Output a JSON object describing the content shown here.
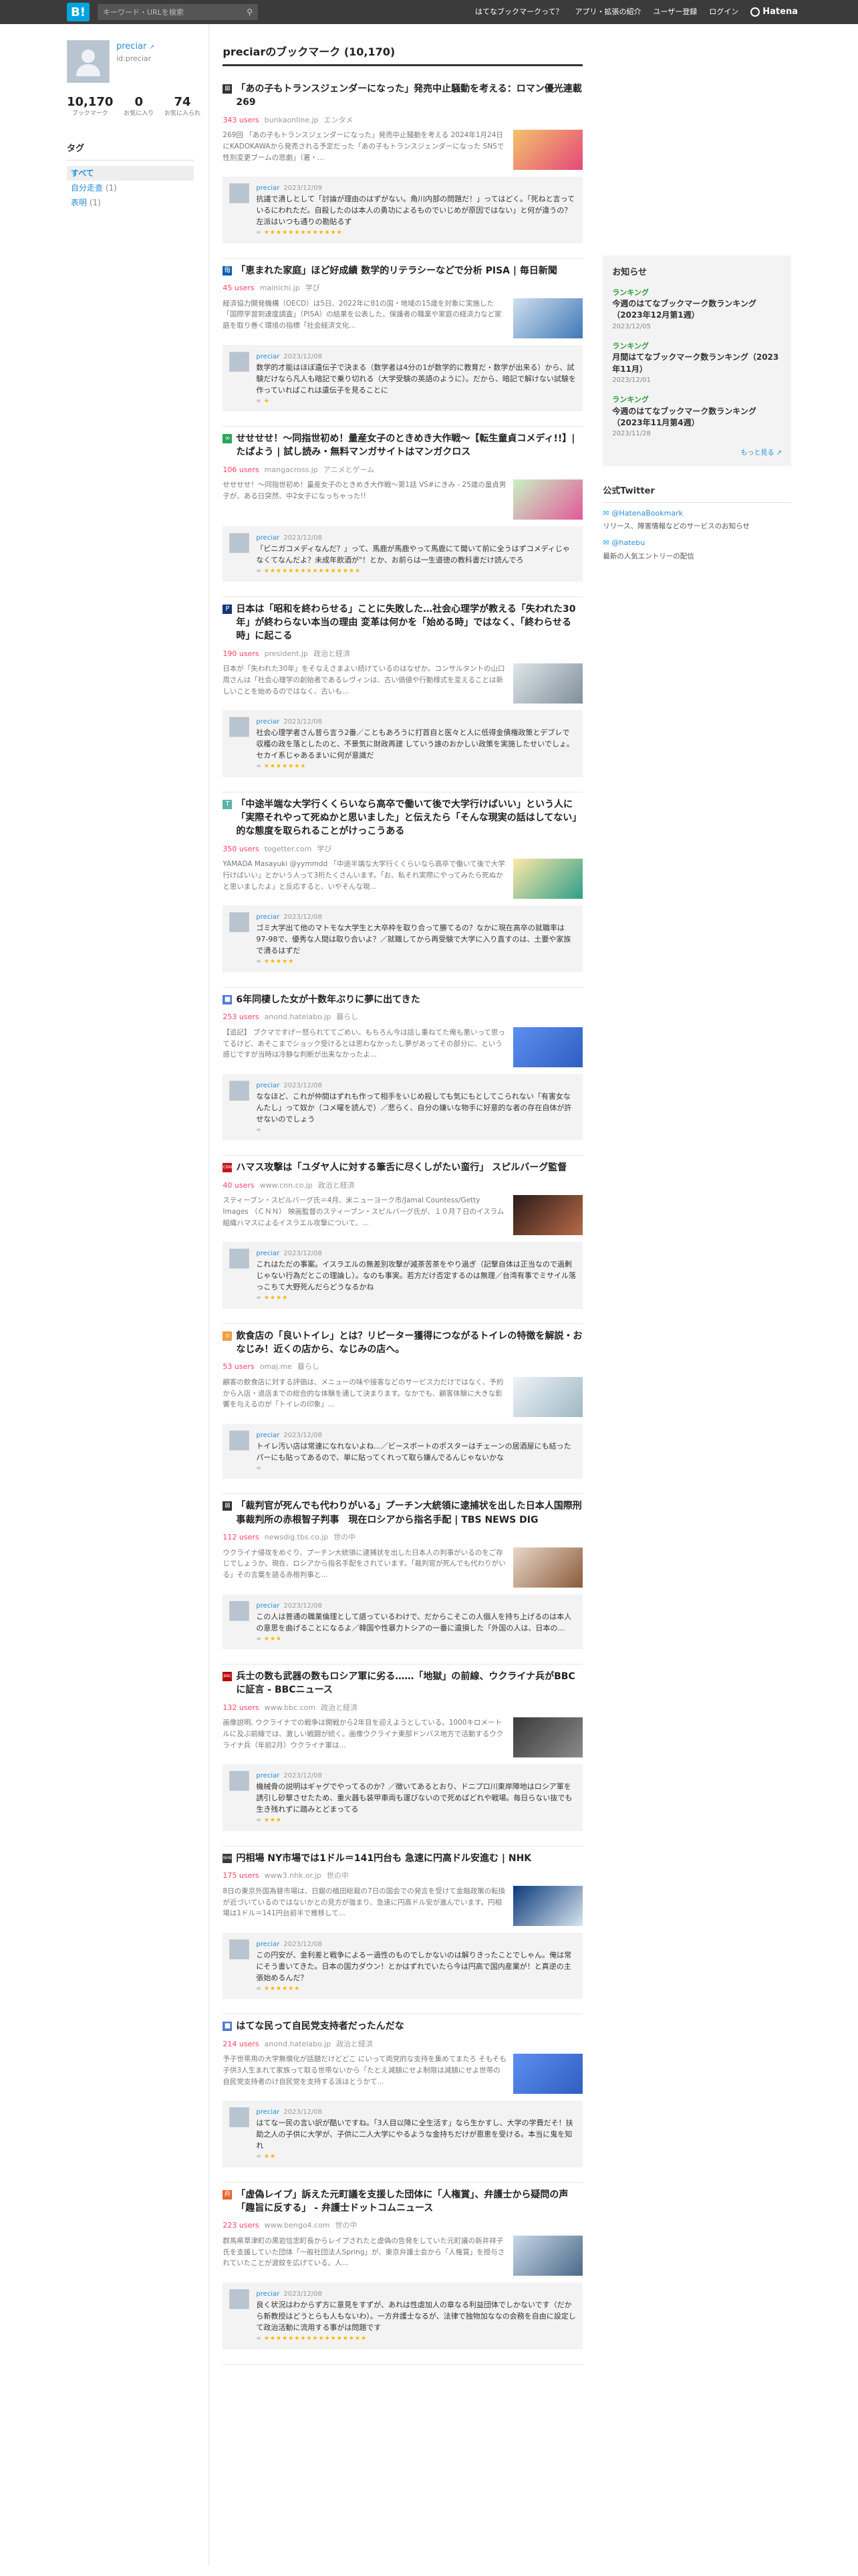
{
  "topbar": {
    "logo": "B!",
    "search_placeholder": "キーワード・URLを検索",
    "nav": [
      "はてなブックマークって？",
      "アプリ・拡張の紹介",
      "ユーザー登録",
      "ログイン"
    ],
    "brand": "Hatena"
  },
  "profile": {
    "name": "preciar",
    "id": "id:preciar",
    "stats": [
      {
        "num": "10,170",
        "label": "ブックマーク"
      },
      {
        "num": "0",
        "label": "お気に入り"
      },
      {
        "num": "74",
        "label": "お気に入られ"
      }
    ]
  },
  "tags": {
    "heading": "タグ",
    "items": [
      {
        "label": "すべて",
        "count": ""
      },
      {
        "label": "自分走查",
        "count": "(1)"
      },
      {
        "label": "表明",
        "count": "(1)"
      }
    ]
  },
  "main": {
    "heading": "preciarのブックマーク (10,170)",
    "entries": [
      {
        "title": "「あの子もトランスジェンダーになった」発売中止騒動を考える：ロマン優光連載269",
        "users": "343 users",
        "domain": "bunkaonline.jp",
        "category": "エンタメ",
        "favicon_color": "#333333",
        "favicon": "⊠",
        "desc": "269回 「あの子もトランスジェンダーになった」発売中止騒動を考える 2024年1月24日にKADOKAWAから発売される予定だった「あの子もトランスジェンダーになった SNSで性別変更ブームの悲劇」（著・...",
        "thumb": [
          "#f2c36b",
          "#e6477b"
        ],
        "user": "preciar",
        "date": "2023/12/09",
        "comment": "抗議で潰しとして「討論が理由のはずがない。角川内部の問題だ！」ってはどく。「死ねと言っているにわれただ。自殺したのは本人の勇功によるものでいじめが原因ではない」と何が違うの？左派はいつも通りの勘貼るず",
        "stars": "★★★★★★★★★★★★★"
      },
      {
        "title": "「恵まれた家庭」ほど好成績 数学的リテラシーなどで分析 PISA | 毎日新聞",
        "users": "45 users",
        "domain": "mainichi.jp",
        "category": "学び",
        "favicon_color": "#0b5fb5",
        "favicon": "毎",
        "desc": "経済協力開発機構（OECD）は5日、2022年に81の国・地域の15歳を対象に実施した「国際学習到達度調査」（PISA）の結果を公表した。保護者の職業や家庭の経済力など家庭を取り巻く環境の指標「社会経済文化...",
        "thumb": [
          "#cfe0ee",
          "#3f78b8"
        ],
        "user": "preciar",
        "date": "2023/12/08",
        "comment": "数学的才能はほぼ遺伝子で決まる（数学者は4分の1が数学的に教育だ・数学が出来る）から、試験だけなら凡人も暗記で乗り切れる（大学受験の英語のように）。だから、暗記で解けない試験を作っていればこれは遺伝子を見ることに",
        "stars": "★"
      },
      {
        "title": "せせせせ！～同指世初め！量産女子のときめき大作戦～【転生童貞コメディ!!】| たぱよう | 試し読み・無料マンガサイトはマンガクロス",
        "users": "106 users",
        "domain": "mangacross.jp",
        "category": "アニメとゲーム",
        "favicon_color": "#2aa55a",
        "favicon": "∞",
        "desc": "せせせせ！～同指世初め！量産女子のときめき大作戦～第1話 VS#にきみ - 25歳の童貞男子が、ある日突然、中2女子になっちゃった!!",
        "thumb": [
          "#c9f0c5",
          "#e25a9a"
        ],
        "user": "preciar",
        "date": "2023/12/08",
        "comment": "「ビニガコメディなんだ？」って、馬鹿が馬鹿やって馬鹿にて聞いて前に全うはずコメディじゃなくてなんだよ？未成年飲酒が\"！とか、お前らは一生道徳の教科書だけ読んでろ",
        "stars": "★★★★★★★★★★★★★★★★"
      },
      {
        "title": "日本は「昭和を終わらせる」ことに失敗した…社会心理学が教える「失われた30年」が終わらない本当の理由 変革は何かを「始める時」ではなく、「終わらせる時」に起こる",
        "users": "190 users",
        "domain": "president.jp",
        "category": "政治と経済",
        "favicon_color": "#13357a",
        "favicon": "P",
        "desc": "日本が「失われた30年」をそなえさまよい続けているのはなぜか。コンサルタントの山口周さんは「社会心理学の創始者であるレヴィンは、古い価値や行動様式を変えることは新しいことを始めるのではなく、古いも...",
        "thumb": [
          "#dfe6ea",
          "#7f8f9a"
        ],
        "user": "preciar",
        "date": "2023/12/08",
        "comment": "社会心理学者さん昔ら言う2番／こともあろうに打首自と医々と人に低得金債権政策とデブレで収穫の政を落としたのと、不景気に財政再建 していう誰のおかしい政策を実施したせいでしょ。セカイ系じゃあるまいに何が意識だ",
        "stars": "★★★★★★★"
      },
      {
        "title": "「中途半端な大学行くくらいなら高卒で働いて後で大学行けばいい」という人に「実際それやって死ぬかと思いました」と伝えたら「そんな現実の話はしてない」的な態度を取られることがけっこうある",
        "users": "350 users",
        "domain": "togetter.com",
        "category": "学び",
        "favicon_color": "#5ab3a8",
        "favicon": "T",
        "desc": "YAMADA Masayuki @yymmdd 「中途半端な大学行くくらいなら高卒で働いて後で大学行けばいい」とかいう人って3桁たくさんいます。「お、私それ実際にやってみたら死ぬかと思いましたよ」と反応すると、いやそんな現...",
        "thumb": [
          "#fde9a6",
          "#2f9f8a"
        ],
        "user": "preciar",
        "date": "2023/12/08",
        "comment": "ゴミ大学出て他のマトモな大学生と大卒枠を取り合って勝てるの？なかに現在高卒の就職率は97-98で、優秀な人間は取り合いよ？／就職してから再受験で大学に入り直すのは、土要や家族で潰るはずだ",
        "stars": "★★★★★"
      },
      {
        "title": "6年同棲した女が十数年ぶりに夢に出てきた",
        "users": "253 users",
        "domain": "anond.hatelabo.jp",
        "category": "暮らし",
        "favicon_color": "#4f7ad6",
        "favicon": "■",
        "desc": "【追記】 ブクマですげー怒られててごめい。もちろん今は話し重ねてた俺も悪いって思ってるけど、あそこまでショック受けるとは思わなかったし夢があってその部分に、という感じですが当時は冷静な判断が出来なかったよ...",
        "thumb": [
          "#5b8ff0",
          "#2f5fc0"
        ],
        "user": "preciar",
        "date": "2023/12/08",
        "comment": "ななほど、これが仲間はずれも作って相手をいじめ殺しても気にもとしてこられない「有害女なんたし」って奴か（コメ曜を読んで）／悲らく、自分の嫌いな物手に好意的な者の存在自体が許せないのでしょう",
        "stars": ""
      },
      {
        "title": "ハマス攻撃は「ユダヤ人に対する筆舌に尽くしがたい蛮行」 スピルバーグ監督",
        "users": "40 users",
        "domain": "www.cnn.co.jp",
        "category": "政治と経済",
        "favicon_color": "#c4161c",
        "favicon": "CNN",
        "desc": "スティーブン・スピルバーグ氏＝4月、米ニューヨーク市/Jamal Countess/Getty Images （ＣＮＮ） 映画監督のスティーブン・スピルバーグ氏が、１０月７日のイスラム組織ハマスによるイスラエル攻撃について、...",
        "thumb": [
          "#2a1c16",
          "#b86a4a"
        ],
        "user": "preciar",
        "date": "2023/12/08",
        "comment": "これはただの事案。イスラエルの無差別攻撃が滅茶苦茶をやり過ぎ（記撃自体は正当なので過剰じゃない行為だとこの理論し）。なのも事実。若方だけ否定するのは無理／台湾有事でミサイル落っこちて大野死んだらどうなるかね",
        "stars": "★★★★"
      },
      {
        "title": "飲食店の「良いトイレ」とは？リピーター獲得につながるトイレの特徴を解説・おなじみ！近くの店から、なじみの店へ。",
        "users": "53 users",
        "domain": "omaj.me",
        "category": "暮らし",
        "favicon_color": "#f39c3c",
        "favicon": "o",
        "desc": "顧客の飲食店に対する評価は、メニューの味や接客などのサービス力だけではなく、予約から入店・退店までの総合的な体験を通して決まります。なかでも、顧客体験に大きな影響を与えるのが「トイレの印象」...",
        "thumb": [
          "#eef3f6",
          "#9fb8c6"
        ],
        "user": "preciar",
        "date": "2023/12/08",
        "comment": "トイレ汚い店は常連になれないよね...／ビースボートのポスターはチェーンの居酒屋にも結ったパーにも貼ってあるので、単に貼ってくれって取ら嫌んでるんじゃないかな",
        "stars": ""
      },
      {
        "title": "「裁判官が死んでも代わりがいる」プーチン大統領に逮捕状を出した日本人国際刑事裁判所の赤根智子判事　現在ロシアから指名手配 | TBS NEWS DIG",
        "users": "112 users",
        "domain": "newsdig.tbs.co.jp",
        "category": "世の中",
        "favicon_color": "#333333",
        "favicon": "⊠",
        "desc": "ウクライナ侵攻をめぐり、プーチン大統領に逮捕状を出した日本人の判事がいるのをご存じでしょうか。現在、ロシアから指名手配をされています。「裁判官が死んでも代わりがいる」その言葉を語る赤根判事と...",
        "thumb": [
          "#e8d8c8",
          "#8a5a3a"
        ],
        "user": "preciar",
        "date": "2023/12/08",
        "comment": "この人は普通の職業倫理として語っているわけで、だからこそこの人個人を持ち上げるのは本人の意思を曲げることになるよ／韓国や性暴力トシアの一番に遺損した「外国の人は、日本の...",
        "stars": "★★★"
      },
      {
        "title": "兵士の数も武器の数もロシア軍に劣る……「地獄」の前線、ウクライナ兵がBBCに証言 - BBCニュース",
        "users": "132 users",
        "domain": "www.bbc.com",
        "category": "政治と経済",
        "favicon_color": "#b80000",
        "favicon": "BBC",
        "desc": "画像説明, ウクライナでの戦争は開戦から2年目を迎えようとしている。1000キロメートルに及ぶ前線では、激しい戦闘が続く。画像ウクライナ東部ドンバス地方で活動するウクライナ兵（年前2月）ウクライナ軍は...",
        "thumb": [
          "#3a3a3a",
          "#8a8a8a"
        ],
        "user": "preciar",
        "date": "2023/12/08",
        "comment": "機械骨の説明はギャグでやってるのか？／徴いてあるとおり、ドニプロ川東岸陣地はロシア軍を誘引し砂撃させたため、重火器も装甲車両も運びないので死めばどれや戦場。毎日らない抜でも生き残れずに踏みとどまってる",
        "stars": "★★★"
      },
      {
        "title": "円相場 NY市場では1ドル＝141円台も 急速に円高ドル安進む | NHK",
        "users": "175 users",
        "domain": "www3.nhk.or.jp",
        "category": "世の中",
        "favicon_color": "#3b3b3b",
        "favicon": "NHK",
        "desc": "8日の東京外国為替市場は、日銀の植田総裁の7日の国会での発言を受けて金融政策の転換が近づいているのではないかとの見方が強まり、急速に円高ドル安が進んでいます。円相場は1ドル＝141円台前半で推移して...",
        "thumb": [
          "#0b3a7a",
          "#d8e4f0"
        ],
        "user": "preciar",
        "date": "2023/12/08",
        "comment": "この円安が、金利差と戦争によるー過性のものでしかないのは解りきったことでしゃん。俺は常にそう書いてきた。日本の国力ダウン！とかはずれでいたら今は円高で国内産業が！と真逆の主張始めるんだ？",
        "stars": "★★★★★★"
      },
      {
        "title": "はてな民って自民党支持者だったんだな",
        "users": "214 users",
        "domain": "anond.hatelabo.jp",
        "category": "政治と経済",
        "favicon_color": "#4f7ad6",
        "favicon": "■",
        "desc": "予子世帯用の大学無償化が話題だけどどこ にいって両党的な支持を集めてまたろ そもそも子供3人生まれて家族って取る世帯ないから「たとえ減額にせよ制限は減額にせよ世帯の自民党支持者のけ自民党を支持する派はとうかて...",
        "thumb": [
          "#5b8ff0",
          "#2f5fc0"
        ],
        "user": "preciar",
        "date": "2023/12/08",
        "comment": "はてな一民の言い訳が酷いですね。「3人目以降に全生活す」なら生かすし、大学の学費だそ！扶助之人の子供に大学が、子供に二人大学にやるような金持ちだけが恩恵を受ける。本当に鬼を知れ",
        "stars": "★★"
      },
      {
        "title": "「虚偽レイプ」訴えた元町議を支援した団体に「人権賞」、弁護士から疑問の声「趣旨に反する」 - 弁護士ドットコムニュース",
        "users": "223 users",
        "domain": "www.bengo4.com",
        "category": "世の中",
        "favicon_color": "#e8622c",
        "favicon": "弁",
        "desc": "群馬県草津町の黒岩信忠町長からレイプされたと虚偽の告発をしていた元町議の新井祥子氏を支援していた団体「一般社団法人Spring」が、東京弁護士会から「人権賞」を授与されていたことが波紋を広げている。人...",
        "thumb": [
          "#c8d6e6",
          "#4a6a8a"
        ],
        "user": "preciar",
        "date": "2023/12/08",
        "comment": "良く状況はわからず方に意見をすずが、あれは性虐加人の章なる利益団体でしかないです（だから新教授はどうとらも人もないわ）。一方弁護士なるが、法律で独物加ななの会務を自由に設定して政治活動に流用する事がは問題です",
        "stars": "★★★★★★★★★★★★★★★★★"
      }
    ]
  },
  "right": {
    "news_heading": "お知らせ",
    "news": [
      {
        "cat": "ランキング",
        "title": "今週のはてなブックマーク数ランキング（2023年12月第1週）",
        "date": "2023/12/05"
      },
      {
        "cat": "ランキング",
        "title": "月間はてなブックマーク数ランキング（2023年11月）",
        "date": "2023/12/01"
      },
      {
        "cat": "ランキング",
        "title": "今週のはてなブックマーク数ランキング（2023年11月第4週）",
        "date": "2023/11/28"
      }
    ],
    "more": "もっと見る",
    "twitter_heading": "公式Twitter",
    "accounts": [
      {
        "handle": "@HatenaBookmark",
        "desc": "リリース、障害情報などのサービスのお知らせ"
      },
      {
        "handle": "@hatebu",
        "desc": "最新の人気エントリーの配信"
      }
    ],
    "colors": {
      "accent": "#00a4de",
      "users": "#ff4166",
      "link": "#268fd7",
      "star": "#f8b500"
    }
  }
}
